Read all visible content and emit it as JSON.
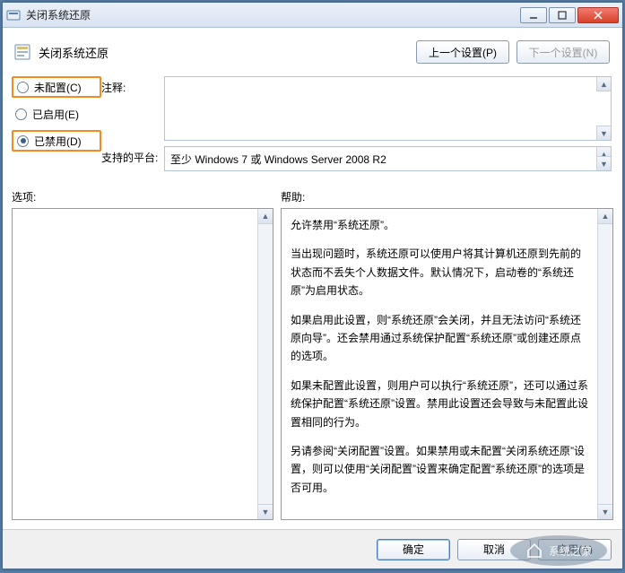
{
  "window": {
    "title": "关闭系统还原"
  },
  "header": {
    "title": "关闭系统还原",
    "prev_btn": "上一个设置(P)",
    "next_btn": "下一个设置(N)"
  },
  "radios": {
    "not_configured": "未配置(C)",
    "enabled": "已启用(E)",
    "disabled": "已禁用(D)",
    "selected": "disabled"
  },
  "labels": {
    "comment": "注释:",
    "platform": "支持的平台:",
    "options": "选项:",
    "help": "帮助:"
  },
  "platform_text": "至少 Windows 7 或 Windows Server 2008 R2",
  "help_paragraphs": [
    "允许禁用“系统还原”。",
    "当出现问题时，系统还原可以使用户将其计算机还原到先前的状态而不丢失个人数据文件。默认情况下，启动卷的“系统还原”为启用状态。",
    "如果启用此设置，则“系统还原”会关闭，并且无法访问“系统还原向导”。还会禁用通过系统保护配置“系统还原”或创建还原点的选项。",
    "如果未配置此设置，则用户可以执行“系统还原”，还可以通过系统保护配置“系统还原”设置。禁用此设置还会导致与未配置此设置相同的行为。",
    "另请参阅“关闭配置”设置。如果禁用或未配置“关闭系统还原”设置，则可以使用“关闭配置”设置来确定配置“系统还原”的选项是否可用。"
  ],
  "footer": {
    "ok": "确定",
    "cancel": "取消",
    "apply": "应用(A)"
  },
  "watermark": "系统之家"
}
